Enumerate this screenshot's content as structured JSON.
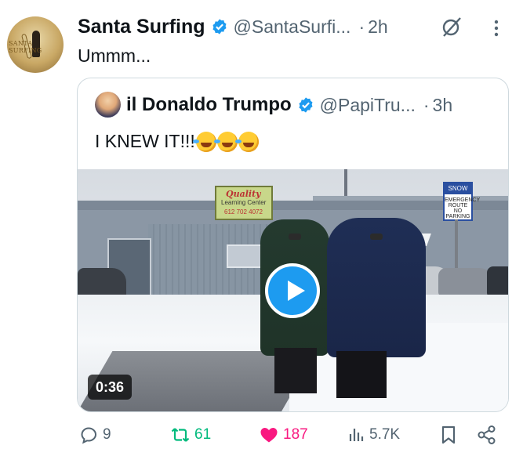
{
  "tweet": {
    "author_name": "Santa Surfing",
    "handle": "@SantaSurfi...",
    "separator": "·",
    "time": "2h",
    "text": "Ummm...",
    "avatar_text": "SANTA SURFING"
  },
  "quote": {
    "author_name": "il Donaldo Trumpo",
    "handle": "@PapiTru...",
    "separator": "·",
    "time": "3h",
    "text": "I KNEW IT!!!",
    "emojis": [
      "rolling-on-floor-laughing",
      "rolling-on-floor-laughing",
      "rolling-on-floor-laughing"
    ],
    "media": {
      "duration": "0:36",
      "store_sign": {
        "line1": "Quality",
        "line2": "Learning Center",
        "line3": "612 702 4072"
      },
      "street_sign": {
        "line1": "SNOW",
        "line2": "EMERGENCY ROUTE",
        "line3": "NO PARKING"
      }
    }
  },
  "actions": {
    "replies": "9",
    "reposts": "61",
    "likes": "187",
    "views": "5.7K"
  },
  "colors": {
    "verified": "#1d9bf0",
    "repost": "#00ba7c",
    "like": "#f91880",
    "muted": "#536471"
  }
}
